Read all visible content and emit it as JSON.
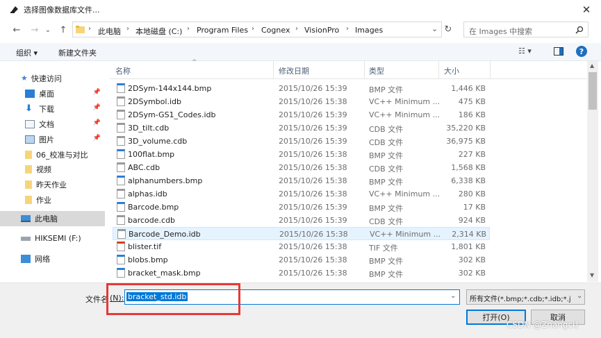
{
  "window": {
    "title": "选择图像数据库文件...",
    "close_glyph": "✕"
  },
  "nav": {
    "back": "←",
    "forward": "→",
    "dropdown": "⌄",
    "up": "↑"
  },
  "address": {
    "crumbs": [
      "此电脑",
      "本地磁盘 (C:)",
      "Program Files",
      "Cognex",
      "VisionPro",
      "Images"
    ],
    "separator": "›",
    "dropdown": "⌄",
    "refresh": "↻"
  },
  "search": {
    "placeholder": "在 Images 中搜索",
    "icon": "search-icon"
  },
  "commandbar": {
    "organize": "组织 ▾",
    "new_folder": "新建文件夹",
    "view": "☷ ▾",
    "help": "?"
  },
  "sidebar": [
    {
      "label": "快速访问",
      "icon": "star-icon",
      "pinned": false
    },
    {
      "label": "桌面",
      "icon": "desktop-icon",
      "pinned": true
    },
    {
      "label": "下载",
      "icon": "download-icon",
      "pinned": true
    },
    {
      "label": "文档",
      "icon": "document-icon",
      "pinned": true
    },
    {
      "label": "图片",
      "icon": "picture-icon",
      "pinned": true
    },
    {
      "label": "06_校准与对比",
      "icon": "folder-icon",
      "pinned": false
    },
    {
      "label": "视频",
      "icon": "folder-icon",
      "pinned": false
    },
    {
      "label": "昨天作业",
      "icon": "folder-icon",
      "pinned": false
    },
    {
      "label": "作业",
      "icon": "folder-icon",
      "pinned": false
    },
    {
      "label": "此电脑",
      "icon": "computer-icon",
      "pinned": false
    },
    {
      "label": "HIKSEMI (F:)",
      "icon": "drive-icon",
      "pinned": false
    },
    {
      "label": "网络",
      "icon": "network-icon",
      "pinned": false
    }
  ],
  "columns": {
    "name": "名称",
    "date": "修改日期",
    "type": "类型",
    "size": "大小"
  },
  "files": [
    {
      "name": "2DSym-144x144.bmp",
      "date": "2015/10/26 15:39",
      "type": "BMP 文件",
      "size": "1,446 KB"
    },
    {
      "name": "2DSymbol.idb",
      "date": "2015/10/26 15:38",
      "type": "VC++ Minimum ...",
      "size": "475 KB"
    },
    {
      "name": "2DSym-GS1_Codes.idb",
      "date": "2015/10/26 15:39",
      "type": "VC++ Minimum ...",
      "size": "186 KB"
    },
    {
      "name": "3D_tilt.cdb",
      "date": "2015/10/26 15:39",
      "type": "CDB 文件",
      "size": "35,220 KB"
    },
    {
      "name": "3D_volume.cdb",
      "date": "2015/10/26 15:39",
      "type": "CDB 文件",
      "size": "36,975 KB"
    },
    {
      "name": "100flat.bmp",
      "date": "2015/10/26 15:38",
      "type": "BMP 文件",
      "size": "227 KB"
    },
    {
      "name": "ABC.cdb",
      "date": "2015/10/26 15:38",
      "type": "CDB 文件",
      "size": "1,568 KB"
    },
    {
      "name": "alphanumbers.bmp",
      "date": "2015/10/26 15:38",
      "type": "BMP 文件",
      "size": "6,338 KB"
    },
    {
      "name": "alphas.idb",
      "date": "2015/10/26 15:38",
      "type": "VC++ Minimum ...",
      "size": "280 KB"
    },
    {
      "name": "Barcode.bmp",
      "date": "2015/10/26 15:39",
      "type": "BMP 文件",
      "size": "17 KB"
    },
    {
      "name": "barcode.cdb",
      "date": "2015/10/26 15:39",
      "type": "CDB 文件",
      "size": "924 KB"
    },
    {
      "name": "Barcode_Demo.idb",
      "date": "2015/10/26 15:38",
      "type": "VC++ Minimum ...",
      "size": "2,314 KB",
      "selected": true
    },
    {
      "name": "blister.tif",
      "date": "2015/10/26 15:38",
      "type": "TIF 文件",
      "size": "1,801 KB"
    },
    {
      "name": "blobs.bmp",
      "date": "2015/10/26 15:38",
      "type": "BMP 文件",
      "size": "302 KB"
    },
    {
      "name": "bracket_mask.bmp",
      "date": "2015/10/26 15:38",
      "type": "BMP 文件",
      "size": "302 KB"
    }
  ],
  "bottom": {
    "filename_label": "文件名",
    "filename_accel": "(N):",
    "filename_value": "bracket_std.idb",
    "filter": "所有文件(*.bmp;*.cdb;*.idb;*.j",
    "open": "打开(O)",
    "cancel": "取消"
  },
  "watermark": "CSDN @Zhangci]",
  "colors": {
    "selection": "#e5f3ff",
    "highlight_box": "#e53935",
    "input_selection": "#0078d7"
  }
}
